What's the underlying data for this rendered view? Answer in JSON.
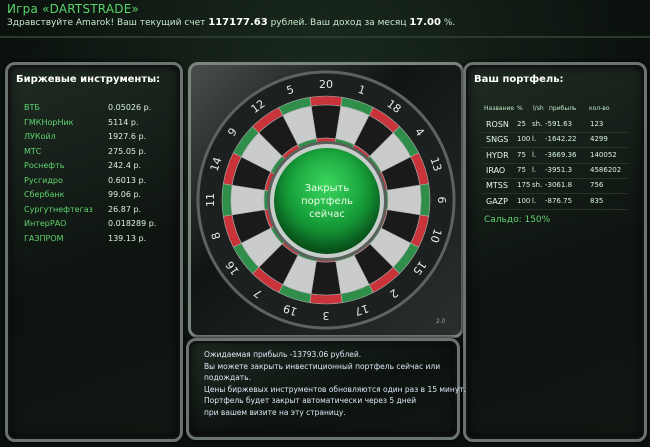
{
  "header": {
    "title": "Игра «DARTSTRADE»",
    "greeting": "Здравствуйте Amarok! Ваш текущий счет",
    "balance": "117177.63",
    "mid": "рублей. Ваш доход за месяц",
    "income": "17.00",
    "tail": "%."
  },
  "instruments": {
    "title": "Биржевые инструменты:",
    "items": [
      {
        "name": "ВТБ",
        "price": "0.05026 р."
      },
      {
        "name": "ГМКНорНик",
        "price": "5114 р."
      },
      {
        "name": "ЛУКойл",
        "price": "1927.6 р."
      },
      {
        "name": "МТС",
        "price": "275.05 р."
      },
      {
        "name": "Роснефть",
        "price": "242.4 р."
      },
      {
        "name": "Русгидро",
        "price": "0.6013 р."
      },
      {
        "name": "Сбербанк",
        "price": "99.06 р."
      },
      {
        "name": "Сургутнефтегаз",
        "price": "26.87 р."
      },
      {
        "name": "ИнтерРАО",
        "price": "0.018289 р."
      },
      {
        "name": "ГАЗПРОМ",
        "price": "139.13 р."
      }
    ]
  },
  "dartboard": {
    "numbers": [
      "20",
      "1",
      "18",
      "4",
      "13",
      "6",
      "10",
      "15",
      "2",
      "17",
      "3",
      "19",
      "7",
      "16",
      "8",
      "11",
      "14",
      "9",
      "12",
      "5"
    ],
    "button_label": [
      "Закрыть",
      "портфель",
      "сейчас"
    ],
    "version": "2.0"
  },
  "portfolio": {
    "title": "Ваш портфель:",
    "columns": [
      "Название",
      "%",
      "l/sh",
      "прибыль",
      "кол-во"
    ],
    "rows": [
      {
        "ticker": "ROSN",
        "pct": "25",
        "dir": "sh.",
        "profit": "-591.63",
        "qty": "123"
      },
      {
        "ticker": "SNGS",
        "pct": "100",
        "dir": "l.",
        "profit": "-1642.22",
        "qty": "4299"
      },
      {
        "ticker": "HYDR",
        "pct": "75",
        "dir": "l.",
        "profit": "-3669.36",
        "qty": "140052"
      },
      {
        "ticker": "IRAO",
        "pct": "75",
        "dir": "l.",
        "profit": "-3951.3",
        "qty": "4586202"
      },
      {
        "ticker": "MTSS",
        "pct": "175",
        "dir": "sh.",
        "profit": "-3061.8",
        "qty": "756"
      },
      {
        "ticker": "GAZP",
        "pct": "100",
        "dir": "l.",
        "profit": "-876.75",
        "qty": "835"
      }
    ],
    "saldo": "Сальдо: 150%"
  },
  "message": {
    "lines": [
      "Ожидаемая прибыль -13793.06 рублей.",
      "Вы можете закрыть инвестиционный портфель сейчас или",
      "подождать.",
      "Цены биржевых инструментов обновляются один раз в 15 минут.",
      "Портфель будет закрыт автоматически через 5 дней",
      "при вашем визите на эту страницу."
    ]
  },
  "colors": {
    "accent_green": "#5fd46f",
    "board_red": "#c9343a",
    "board_green": "#2f8f4a"
  }
}
